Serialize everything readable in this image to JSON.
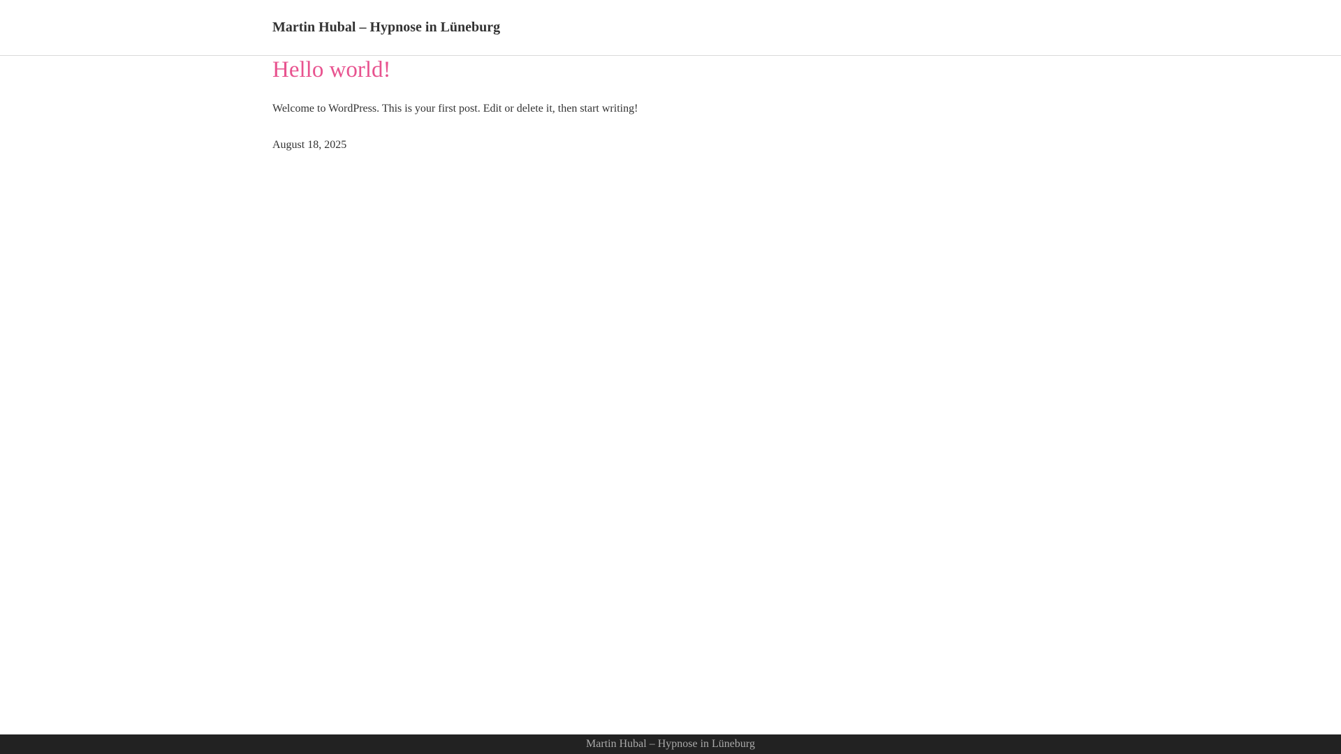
{
  "header": {
    "site_title": "Martin Hubal – Hypnose in Lüneburg"
  },
  "post": {
    "title": "Hello world!",
    "excerpt": "Welcome to WordPress. This is your first post. Edit or delete it, then start writing!",
    "date": "August 18, 2025"
  },
  "footer": {
    "text": "Martin Hubal – Hypnose in Lüneburg"
  },
  "colors": {
    "accent": "#e8538f",
    "text": "#333333",
    "footer_bg": "#222222",
    "footer_text": "#aaaaaa",
    "border": "#d9d9d9"
  }
}
